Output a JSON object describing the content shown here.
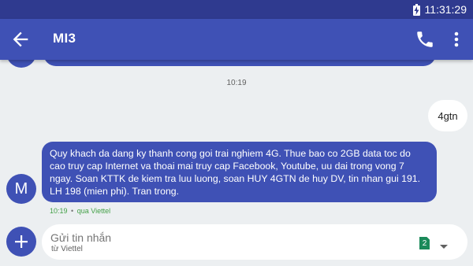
{
  "status_bar": {
    "time": "11:31:29",
    "icons": [
      "battery-charging-icon"
    ]
  },
  "app_bar": {
    "title": "MI3",
    "icons": [
      "back-arrow-icon",
      "phone-icon",
      "more-vert-icon"
    ]
  },
  "conversation": {
    "time_separator": "10:19",
    "outgoing_message": "4gtn",
    "incoming_message": {
      "sender_initial": "M",
      "text": "Quy khach da dang ky thanh cong goi trai nghiem 4G. Thue bao co 2GB data toc do cao truy cap Internet va thoai mai truy cap Facebook, Youtube, uu dai trong vong 7 ngay. Soan KTTK de kiem tra luu luong, soan HUY 4GTN de huy DV, tin nhan gui 191. LH 198 (mien phi). Tran trong.",
      "time": "10:19",
      "separator": "•",
      "via": "qua Viettel"
    }
  },
  "compose": {
    "placeholder": "Gửi tin nhắn",
    "value": "",
    "sub_label": "từ Viettel",
    "sim_slot": "2",
    "icons": [
      "add-icon",
      "dropdown-arrow-icon"
    ]
  },
  "colors": {
    "status_bar": "#2f3a8f",
    "primary": "#3f51b5",
    "background": "#eceff1",
    "sim_badge": "#1b8a5a",
    "meta_text": "#43a047"
  }
}
